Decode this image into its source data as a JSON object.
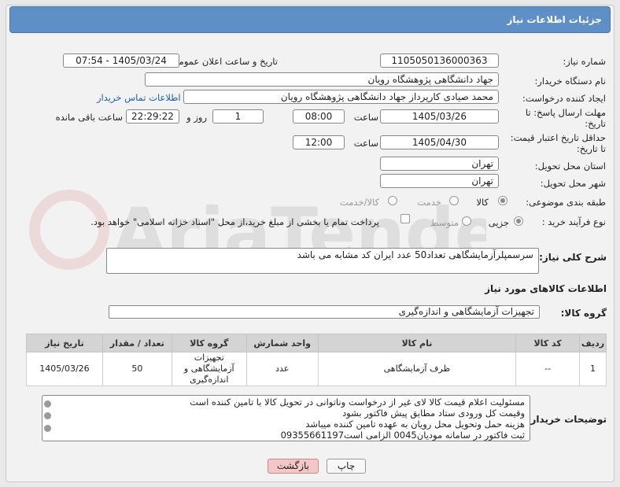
{
  "header": {
    "title": "جزئیات اطلاعات نیاز"
  },
  "form": {
    "need_number_label": "شماره نیاز:",
    "need_number": "1105050136000363",
    "announce_label": "تاریخ و ساعت اعلان عمومی:",
    "announce_value": "1405/03/24 - 07:54",
    "buyer_label": "نام دستگاه خریدار:",
    "buyer_value": "جهاد دانشگاهی پژوهشگاه رویان",
    "creator_label": "ایجاد کننده درخواست:",
    "creator_value": "محمد صیادی کارپرداز جهاد دانشگاهی پژوهشگاه رویان",
    "contact_link": "اطلاعات تماس خریدار",
    "deadline_label_1": "مهلت ارسال پاسخ: تا",
    "deadline_label_2": "تاریخ:",
    "deadline_date": "1405/03/26",
    "time_label": "ساعت",
    "deadline_time": "08:00",
    "days_value": "1",
    "days_label": "روز و",
    "remaining_time": "22:29:22",
    "remaining_label": "ساعت باقی مانده",
    "validity_label_1": "حداقل تاریخ اعتبار قیمت:",
    "validity_label_2": "تا تاریخ:",
    "validity_date": "1405/04/30",
    "validity_time": "12:00",
    "province_label": "استان محل تحویل:",
    "province_value": "تهران",
    "city_label": "شهر محل تحویل:",
    "city_value": "تهران",
    "category_label": "طبقه بندی موضوعی:",
    "category_options": [
      "کالا",
      "خدمت",
      "کالا/خدمت"
    ],
    "process_label": "نوع فرآیند خرید :",
    "process_options": [
      "جزیی",
      "متوسط"
    ],
    "payment_note": "پرداخت تمام یا بخشی از مبلغ خرید،از محل \"اسناد خزانه اسلامی\" خواهد بود."
  },
  "description": {
    "label": "شرح کلی نیاز:",
    "value": "سرسمپلرآزمایشگاهی تعداد50 عدد ایران کد مشابه می باشد"
  },
  "goods_section": {
    "title": "اطلاعات کالاهای مورد نیاز",
    "group_label": "گروه کالا:",
    "group_value": "تجهیزات آزمایشگاهی و اندازه‌گیری"
  },
  "table": {
    "headers": [
      "ردیف",
      "کد کالا",
      "نام کالا",
      "واحد شمارش",
      "گروه کالا",
      "تعداد / مقدار",
      "تاریخ نیاز"
    ],
    "rows": [
      {
        "row": "1",
        "code": "--",
        "name": "ظرف آزمایشگاهی",
        "unit": "عدد",
        "group_line1": "تجهیزات",
        "group_line2": "آزمایشگاهی و",
        "group_line3": "اندازه‌گیری",
        "qty": "50",
        "date": "1405/03/26"
      }
    ]
  },
  "buyer_notes": {
    "label": "توضیحات خریدار:",
    "lines": [
      "مسئولیت اعلام قیمت کالا لای  غیر از درخواست وناتوانی در تحویل کالا با تامین کننده است",
      "وقیمت کل ورودی ستاد مطابق پیش فاکتور بشود",
      "هزینه حمل وتحویل محل رویان به عهده تامین کننده میباشد",
      "ثبت فاکتور در سامانه مودیان0045 الزامی است09355661197"
    ]
  },
  "buttons": {
    "print": "چاپ",
    "back": "بازگشت"
  },
  "watermark": "AriaTender.net",
  "colors": {
    "header_bg": "#5e8fc6",
    "link": "#1a5fb4",
    "back_button_bg": "#f4c7c7"
  }
}
